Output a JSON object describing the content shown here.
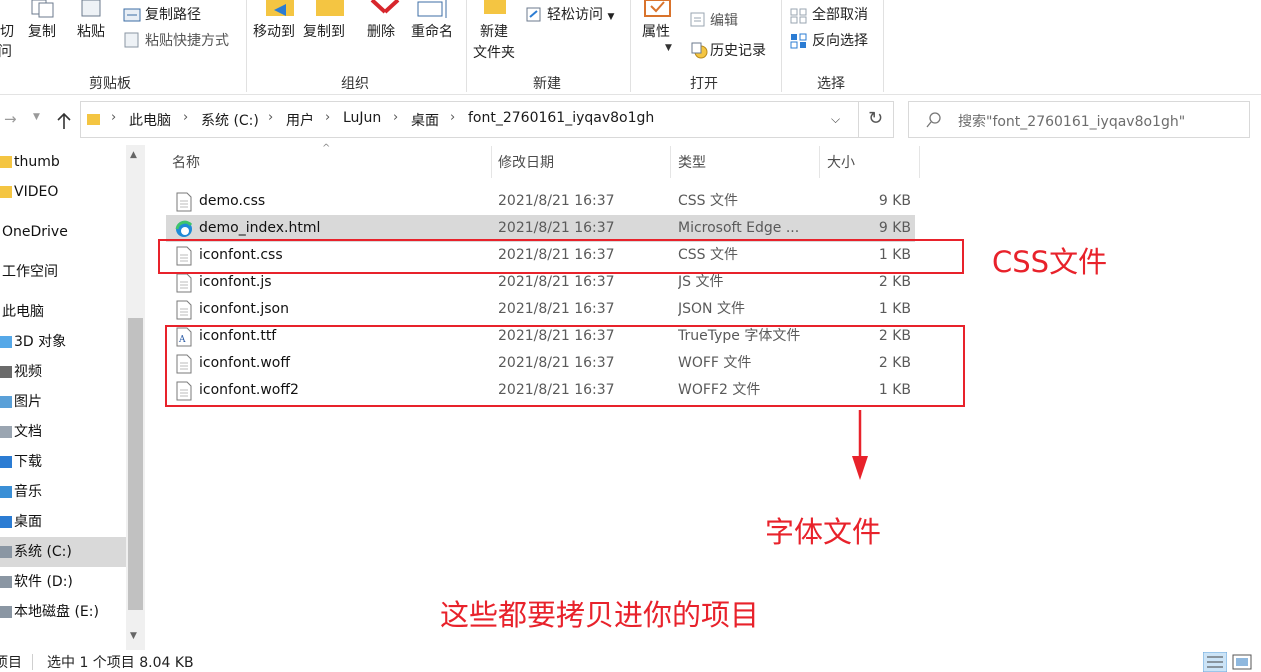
{
  "ribbon": {
    "clipboard": {
      "pin_label": "剪切",
      "copy_label": "复制",
      "paste_label": "粘贴",
      "copy_path_label": "复制路径",
      "paste_shortcut_label": "粘贴快捷方式",
      "group_label": "剪贴板"
    },
    "organize": {
      "move_to_label": "移动到",
      "copy_to_label": "复制到",
      "delete_label": "删除",
      "rename_label": "重命名",
      "group_label": "组织"
    },
    "new": {
      "new_folder_label_1": "新建",
      "new_folder_label_2": "文件夹",
      "easy_access_label": "轻松访问",
      "group_label": "新建"
    },
    "open": {
      "properties_label": "属性",
      "edit_label": "编辑",
      "history_label": "历史记录",
      "group_label": "打开"
    },
    "select": {
      "select_all_label": "全部取消",
      "invert_label": "反向选择",
      "group_label": "选择"
    }
  },
  "address": {
    "crumbs": [
      "此电脑",
      "系统 (C:)",
      "用户",
      "LuJun",
      "桌面",
      "font_2760161_iyqav8o1gh"
    ],
    "search_placeholder": "搜索\"font_2760161_iyqav8o1gh\""
  },
  "nav": {
    "items": [
      {
        "label": "thumb",
        "icon": "folder-icon"
      },
      {
        "label": "VIDEO",
        "icon": "folder-icon"
      },
      {
        "label": "OneDrive",
        "icon": "cloud-icon"
      },
      {
        "label": "工作空间",
        "icon": "folder-icon"
      },
      {
        "label": "此电脑",
        "icon": "computer-icon"
      },
      {
        "label": "3D 对象",
        "icon": "3d-objects-icon"
      },
      {
        "label": "视频",
        "icon": "video-icon"
      },
      {
        "label": "图片",
        "icon": "pictures-icon"
      },
      {
        "label": "文档",
        "icon": "documents-icon"
      },
      {
        "label": "下载",
        "icon": "download-icon"
      },
      {
        "label": "音乐",
        "icon": "music-icon"
      },
      {
        "label": "桌面",
        "icon": "desktop-icon"
      },
      {
        "label": "系统 (C:)",
        "icon": "drive-icon"
      },
      {
        "label": "软件 (D:)",
        "icon": "drive-icon"
      },
      {
        "label": "本地磁盘 (E:)",
        "icon": "drive-icon"
      }
    ]
  },
  "columns": {
    "name": "名称",
    "date": "修改日期",
    "type": "类型",
    "size": "大小"
  },
  "files": [
    {
      "name": "demo.css",
      "date": "2021/8/21 16:37",
      "type": "CSS 文件",
      "size": "9 KB",
      "icon": "file-icon"
    },
    {
      "name": "demo_index.html",
      "date": "2021/8/21 16:37",
      "type": "Microsoft Edge ...",
      "size": "9 KB",
      "icon": "edge-icon"
    },
    {
      "name": "iconfont.css",
      "date": "2021/8/21 16:37",
      "type": "CSS 文件",
      "size": "1 KB",
      "icon": "file-icon"
    },
    {
      "name": "iconfont.js",
      "date": "2021/8/21 16:37",
      "type": "JS 文件",
      "size": "2 KB",
      "icon": "file-icon"
    },
    {
      "name": "iconfont.json",
      "date": "2021/8/21 16:37",
      "type": "JSON 文件",
      "size": "1 KB",
      "icon": "file-icon"
    },
    {
      "name": "iconfont.ttf",
      "date": "2021/8/21 16:37",
      "type": "TrueType 字体文件",
      "size": "2 KB",
      "icon": "font-file-icon"
    },
    {
      "name": "iconfont.woff",
      "date": "2021/8/21 16:37",
      "type": "WOFF 文件",
      "size": "2 KB",
      "icon": "file-icon"
    },
    {
      "name": "iconfont.woff2",
      "date": "2021/8/21 16:37",
      "type": "WOFF2 文件",
      "size": "1 KB",
      "icon": "file-icon"
    }
  ],
  "annotations": {
    "css_label": "CSS文件",
    "font_label": "字体文件",
    "copy_note": "这些都要拷贝进你的项目",
    "color": "#e8222b"
  },
  "status": {
    "items_label": "项目",
    "selection": "选中 1 个项目  8.04 KB"
  },
  "colors": {
    "selection": "#d9d9d9",
    "accent": "#0078d7"
  }
}
